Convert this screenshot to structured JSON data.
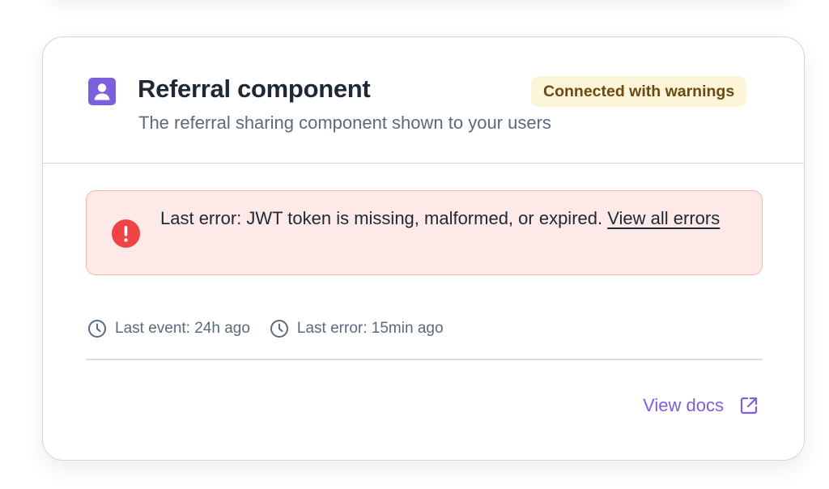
{
  "component": {
    "icon": "user-profile-icon",
    "title": "Referral component",
    "subtitle": "The referral sharing component shown to your users",
    "status": "Connected with warnings"
  },
  "error_banner": {
    "icon": "alert-circle-icon",
    "message": "Last error: JWT token is missing, malformed, or expired.",
    "link_label": "View all errors"
  },
  "meta": {
    "last_event": "Last event: 24h ago",
    "last_error": "Last error: 15min ago"
  },
  "footer": {
    "docs_label": "View docs",
    "docs_icon": "external-link-icon"
  },
  "colors": {
    "accent": "#7c5fdc",
    "warning_bg": "#fdf5d9",
    "warning_text": "#6b4a12",
    "error_bg": "#fde9e7",
    "error_icon": "#ef4444"
  }
}
